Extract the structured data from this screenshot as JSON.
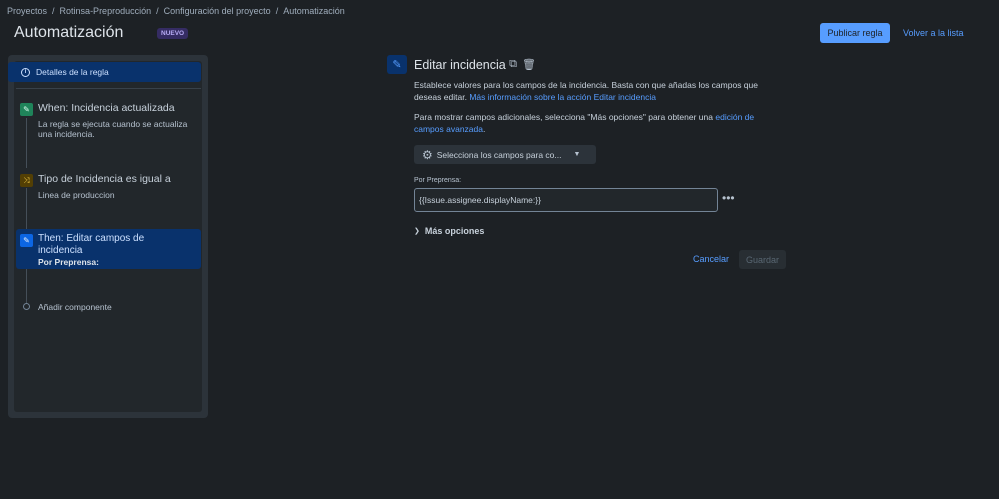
{
  "breadcrumb": {
    "items": [
      "Proyectos",
      "Rotinsa-Preproducción",
      "Configuración del proyecto",
      "Automatización"
    ],
    "separator": "/"
  },
  "header": {
    "title": "Automatización",
    "badge": "NUEVO",
    "publish_label": "Publicar regla",
    "back_label": "Volver a la lista"
  },
  "sidebar": {
    "details_label": "Detalles de la regla",
    "steps": [
      {
        "title": "When: Incidencia actualizada",
        "desc": "La regla se ejecuta cuando se actualiza una incidencia.",
        "icon": "pencil-icon",
        "color": "#1f845a"
      },
      {
        "title": "Tipo de Incidencia es igual a",
        "desc": "Linea de produccion",
        "icon": "shuffle-icon",
        "color": "#7f5f01"
      },
      {
        "title": "Then: Editar campos de incidencia",
        "desc": "Por Preprensa:",
        "icon": "pencil-icon",
        "color": "#0c66e4"
      }
    ],
    "add_label": "Añadir componente"
  },
  "editor": {
    "title": "Editar incidencia",
    "desc1": "Establece valores para los campos de la incidencia. Basta con que añadas los campos que deseas editar.",
    "desc1_link": "Más información sobre la acción Editar incidencia",
    "desc2": "Para mostrar campos adicionales, selecciona \"Más opciones\" para obtener una",
    "desc2_link": "edición de campos avanzada",
    "desc2_end": ".",
    "select_label": "Selecciona los campos para co...",
    "field_label": "Por Preprensa:",
    "field_value": "{{Issue.assignee.displayName:}}",
    "more_options": "Más opciones",
    "cancel": "Cancelar",
    "save": "Guardar"
  },
  "colors": {
    "accent": "#579dff",
    "background": "#1d2125",
    "selected": "#09326c"
  }
}
